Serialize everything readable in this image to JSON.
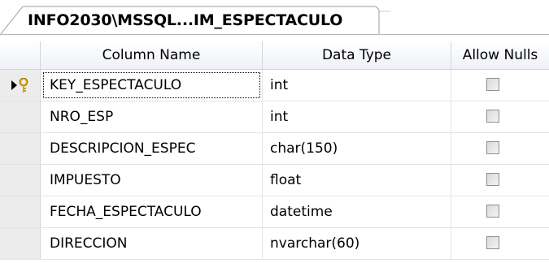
{
  "tab": {
    "title": "INFO2030\\MSSQL...IM_ESPECTACULO"
  },
  "grid": {
    "headers": {
      "column_name": "Column Name",
      "data_type": "Data Type",
      "allow_nulls": "Allow Nulls"
    },
    "rows": [
      {
        "name": "KEY_ESPECTACULO",
        "type": "int",
        "allow_nulls": false,
        "primary_key": true,
        "current": true
      },
      {
        "name": "NRO_ESP",
        "type": "int",
        "allow_nulls": false
      },
      {
        "name": "DESCRIPCION_ESPEC",
        "type": "char(150)",
        "allow_nulls": false
      },
      {
        "name": "IMPUESTO",
        "type": "float",
        "allow_nulls": false
      },
      {
        "name": "FECHA_ESPECTACULO",
        "type": "datetime",
        "allow_nulls": false
      },
      {
        "name": "DIRECCION",
        "type": "nvarchar(60)",
        "allow_nulls": false
      }
    ]
  },
  "icons": {
    "current_row": "row-pointer-icon",
    "primary_key": "key-icon"
  },
  "colors": {
    "key_gold": "#d9a400",
    "selector_bg": "#ececec",
    "grid_line": "#e4e4e4"
  }
}
